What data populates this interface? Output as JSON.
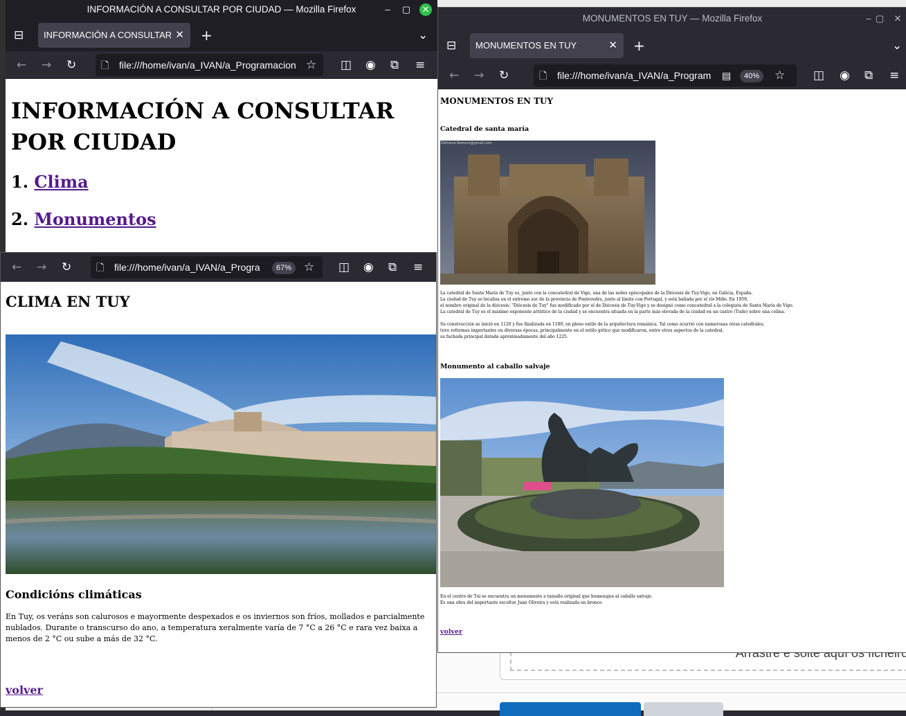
{
  "win1": {
    "title": "INFORMACIÓN A CONSULTAR POR CIUDAD — Mozilla Firefox",
    "tab": "INFORMACIÓN A CONSULTAR POR CIUDAD",
    "url": "file:///home/ivan/a_IVAN/a_Programacion",
    "heading": "INFORMACIÓN A CONSULTAR POR CIUDAD",
    "items": [
      {
        "num": "1.",
        "label": "Clima"
      },
      {
        "num": "2.",
        "label": "Monumentos"
      }
    ]
  },
  "win2": {
    "url": "file:///home/ivan/a_IVAN/a_Progra",
    "zoom": "67%",
    "heading": "CLIMA EN TUY",
    "subheading": "Condicións climáticas",
    "paragraph": "En Tuy, os veráns son calurosos e mayormente despexados e os inviernos son fríos, mollados e parcialmente nublados. Durante o transcurso do ano, a temperatura xeralmente varía de 7 °C a 26 °C e rara vez baixa a menos de 2 °C ou sube a más de 32 °C.",
    "back_link": "volver"
  },
  "win3": {
    "title": "MONUMENTOS EN TUY — Mozilla Firefox",
    "tab": "MONUMENTOS EN TUY",
    "url": "file:///home/ivan/a_IVAN/a_Program",
    "zoom": "40%",
    "heading": "MONUMENTOS EN TUY",
    "section1_title": "Catedral de santa maría",
    "section1_watermark": "Deframe.Romero@gmail.com",
    "section1_text": [
      "La catedral de Santa María de Tuy es, junto con la concatedral de Vigo, una de las sedes episcopales de la Diócesis de Tuy-Vigo, en Galicia, España.",
      "La ciudad de Tuy se localiza en el extremo sur de la provincia de Pontevedra, junto al límite con Portugal, y está bañada por el río Miño. En 1959,",
      "el nombre original de la diócesis: \"Diócesis de Tuy\" fue modificado por el de Diócesis de Tuy-Vigo y se designó como concatedral a la colegiata de Santa María de Vigo.",
      "La catedral de Tuy es el máximo exponente artístico de la ciudad y se encuentra situada en la parte más elevada de la ciudad en un castro (Tude) sobre una colina."
    ],
    "section1_text2": [
      "Su construcción se inició en 1120 y fue finalizada en 1180, en pleno estilo de la arquitectura románica. Tal como ocurrió con numerosas otras catedrales,",
      "tuvo reformas importantes en diversas épocas, principalmente en el estilo gótico que modificaron, entre otros aspectos de la catedral,",
      "su fachada principal datada aproximadamente del año 1225."
    ],
    "section2_title": "Monumento al caballo salvaje",
    "section2_text": [
      "En el centro de Tui se encuentra un monumento a tamaño original que homenajea al caballo salvaje.",
      "Es una obra del importante escultor Juan Oliveira y está realizada en bronce."
    ],
    "back_link": "volver"
  },
  "desktop": {
    "dropzone_text": "Arrastre e solte aquí os ficheiros"
  }
}
